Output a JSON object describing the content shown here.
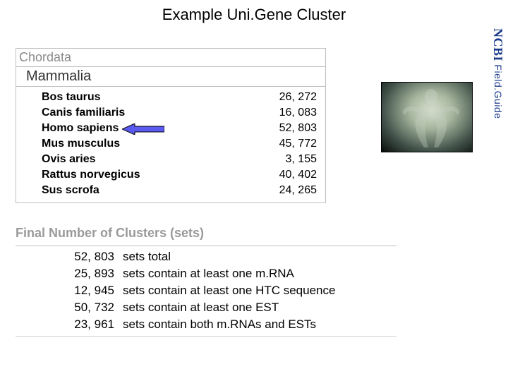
{
  "title": "Example Uni.Gene Cluster",
  "side_label": {
    "bold": "NCBI",
    "thin": " Field.Guide"
  },
  "taxonomy": {
    "phylum": "Chordata",
    "class": "Mammalia",
    "species": [
      {
        "name": "Bos taurus",
        "count": "26, 272"
      },
      {
        "name": "Canis familiaris",
        "count": "16, 083"
      },
      {
        "name": "Homo sapiens",
        "count": "52, 803"
      },
      {
        "name": "Mus musculus",
        "count": "45, 772"
      },
      {
        "name": "Ovis aries",
        "count": "3, 155"
      },
      {
        "name": "Rattus norvegicus",
        "count": "40, 402"
      },
      {
        "name": "Sus scrofa",
        "count": "24, 265"
      }
    ]
  },
  "final": {
    "heading": "Final Number of Clusters (sets)",
    "rows": [
      {
        "num": "52, 803",
        "desc": "sets total"
      },
      {
        "num": "25, 893",
        "desc": "sets contain at least one m.RNA"
      },
      {
        "num": "12, 945",
        "desc": "sets contain at least one HTC sequence"
      },
      {
        "num": "50, 732",
        "desc": "sets contain at least one EST"
      },
      {
        "num": "23, 961",
        "desc": "sets contain both m.RNAs and ESTs"
      }
    ]
  },
  "highlight_index": 2
}
